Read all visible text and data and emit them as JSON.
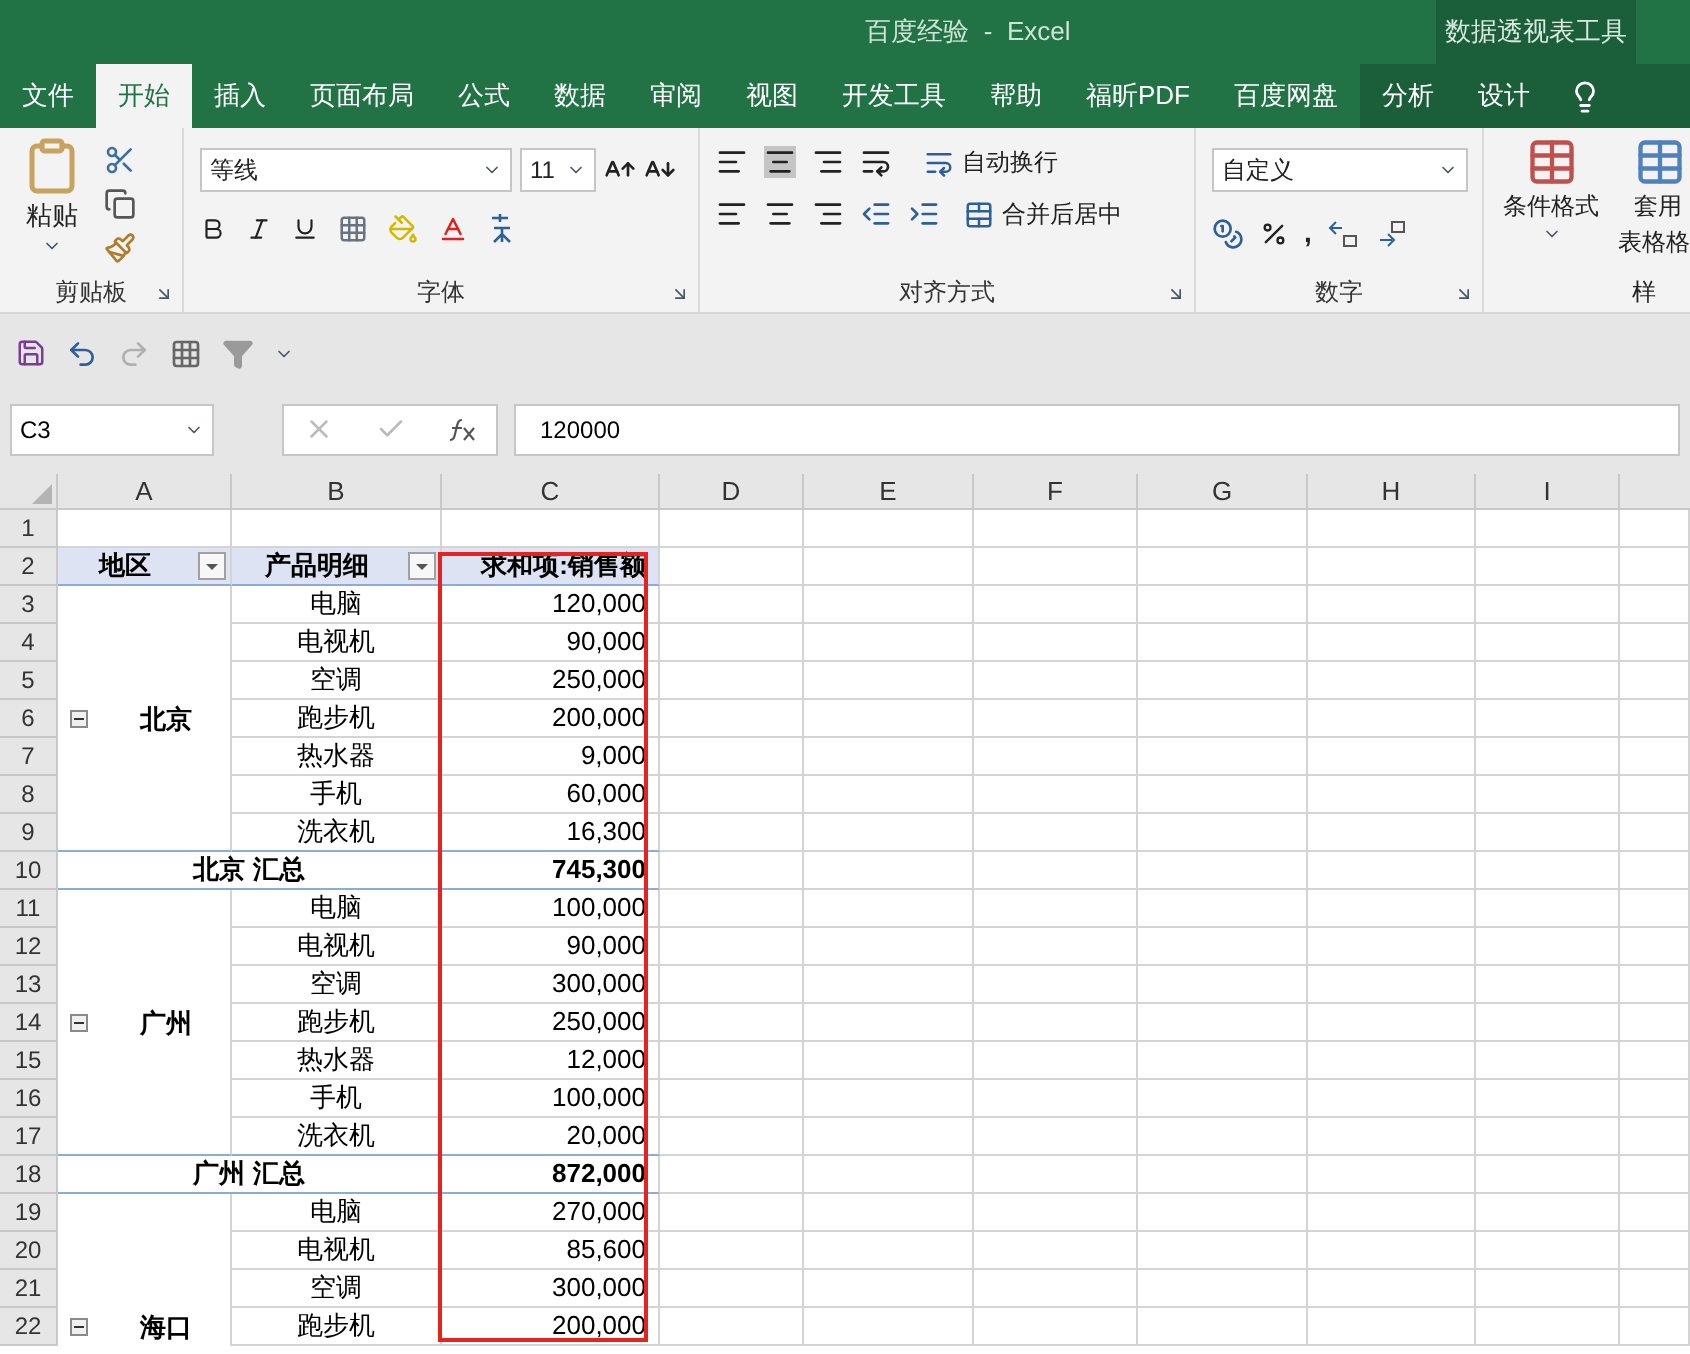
{
  "window": {
    "title": "百度经验  -  Excel",
    "context_title": "数据透视表工具"
  },
  "ribbon_tabs": [
    {
      "label": "文件",
      "kind": "main",
      "selected": false
    },
    {
      "label": "开始",
      "kind": "main",
      "selected": true
    },
    {
      "label": "插入",
      "kind": "main",
      "selected": false
    },
    {
      "label": "页面布局",
      "kind": "main",
      "selected": false
    },
    {
      "label": "公式",
      "kind": "main",
      "selected": false
    },
    {
      "label": "数据",
      "kind": "main",
      "selected": false
    },
    {
      "label": "审阅",
      "kind": "main",
      "selected": false
    },
    {
      "label": "视图",
      "kind": "main",
      "selected": false
    },
    {
      "label": "开发工具",
      "kind": "main",
      "selected": false
    },
    {
      "label": "帮助",
      "kind": "main",
      "selected": false
    },
    {
      "label": "福昕PDF",
      "kind": "main",
      "selected": false
    },
    {
      "label": "百度网盘",
      "kind": "main",
      "selected": false
    },
    {
      "label": "分析",
      "kind": "contextual",
      "selected": false
    },
    {
      "label": "设计",
      "kind": "contextual",
      "selected": false
    }
  ],
  "ribbon": {
    "clipboard": {
      "paste": "粘贴",
      "label": "剪贴板"
    },
    "font": {
      "name": "等线",
      "size": "11",
      "label": "字体"
    },
    "alignment": {
      "wrap_text": "自动换行",
      "merge_center": "合并后居中",
      "label": "对齐方式"
    },
    "number": {
      "format": "自定义",
      "comma": ",",
      "label": "数字"
    },
    "styles": {
      "conditional_format": "条件格式",
      "table_format_1": "套用",
      "table_format_2": "表格格",
      "label": "样"
    }
  },
  "formula_bar": {
    "name_box": "C3",
    "formula": "120000"
  },
  "columns": [
    "A",
    "B",
    "C",
    "D",
    "E",
    "F",
    "G",
    "H",
    "I"
  ],
  "row_numbers": [
    "1",
    "2",
    "3",
    "4",
    "5",
    "6",
    "7",
    "8",
    "9",
    "10",
    "11",
    "12",
    "13",
    "14",
    "15",
    "16",
    "17",
    "18",
    "19",
    "20",
    "21",
    "22"
  ],
  "pivot": {
    "headers": [
      {
        "text": "地区",
        "filter_button": true
      },
      {
        "text": "产品明细",
        "filter_button": true
      },
      {
        "text": "求和项:销售额",
        "filter_button": false
      }
    ],
    "groups": [
      {
        "region": "北京",
        "expanded": true,
        "subtotal_label": "北京 汇总",
        "subtotal": "745,300",
        "items": [
          {
            "product": "电脑",
            "amount": "120,000"
          },
          {
            "product": "电视机",
            "amount": "90,000"
          },
          {
            "product": "空调",
            "amount": "250,000"
          },
          {
            "product": "跑步机",
            "amount": "200,000"
          },
          {
            "product": "热水器",
            "amount": "9,000"
          },
          {
            "product": "手机",
            "amount": "60,000"
          },
          {
            "product": "洗衣机",
            "amount": "16,300"
          }
        ]
      },
      {
        "region": "广州",
        "expanded": true,
        "subtotal_label": "广州 汇总",
        "subtotal": "872,000",
        "items": [
          {
            "product": "电脑",
            "amount": "100,000"
          },
          {
            "product": "电视机",
            "amount": "90,000"
          },
          {
            "product": "空调",
            "amount": "300,000"
          },
          {
            "product": "跑步机",
            "amount": "250,000"
          },
          {
            "product": "热水器",
            "amount": "12,000"
          },
          {
            "product": "手机",
            "amount": "100,000"
          },
          {
            "product": "洗衣机",
            "amount": "20,000"
          }
        ]
      },
      {
        "region": "海口",
        "expanded": true,
        "items": [
          {
            "product": "电脑",
            "amount": "270,000"
          },
          {
            "product": "电视机",
            "amount": "85,600"
          },
          {
            "product": "空调",
            "amount": "300,000"
          },
          {
            "product": "跑步机",
            "amount": "200,000"
          }
        ]
      }
    ]
  }
}
